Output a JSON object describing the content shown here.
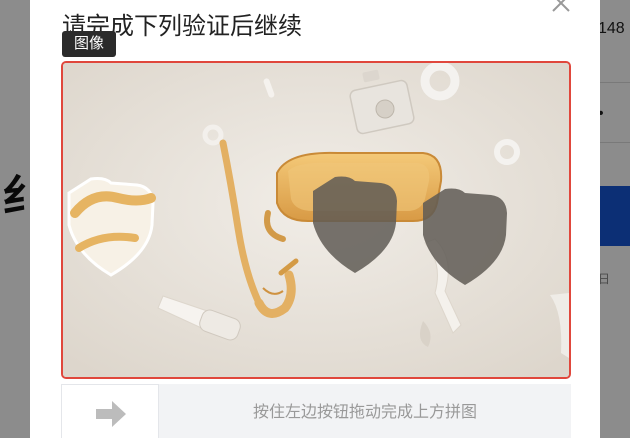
{
  "background": {
    "left_heading_char": "纟",
    "right_number": "148",
    "right_dot": "•",
    "right_small_text": "日"
  },
  "dialog": {
    "title": "请完成下列验证后继续",
    "image_tag": "图像",
    "slider_hint": "按住左边按钮拖动完成上方拼图"
  },
  "colors": {
    "frame_border": "#e0473c",
    "accent_blue": "#1756d6",
    "tag_bg": "#2b2b2b"
  },
  "icons": {
    "close": "close-icon",
    "slider": "right-arrow-icon"
  }
}
